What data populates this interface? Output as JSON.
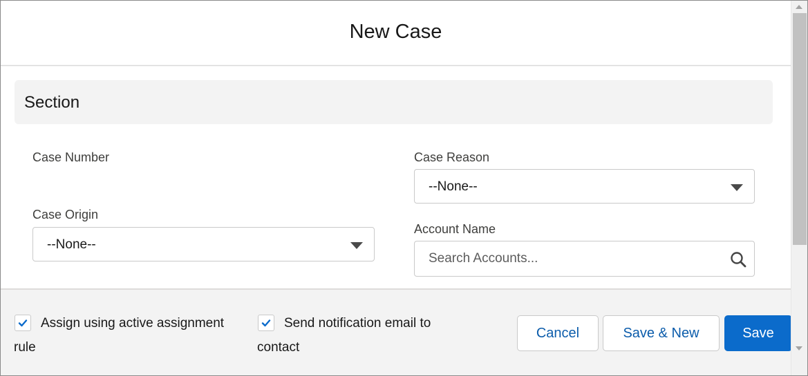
{
  "modal": {
    "title": "New Case"
  },
  "section": {
    "title": "Section"
  },
  "fields": {
    "case_number": {
      "label": "Case Number"
    },
    "case_reason": {
      "label": "Case Reason",
      "value": "--None--"
    },
    "case_origin": {
      "label": "Case Origin",
      "value": "--None--"
    },
    "account_name": {
      "label": "Account Name",
      "placeholder": "Search Accounts..."
    }
  },
  "footer": {
    "assign_rule": {
      "line1": "Assign using active assignment",
      "line2": "rule",
      "checked": true
    },
    "send_email": {
      "line1": "Send notification email to",
      "line2": "contact",
      "checked": true
    },
    "buttons": {
      "cancel": "Cancel",
      "save_new": "Save & New",
      "save": "Save"
    }
  },
  "icons": {
    "search": "search-icon",
    "caret": "chevron-down-icon",
    "check": "check-icon"
  },
  "colors": {
    "brand": "#0b6bcb",
    "link": "#0b5cab",
    "section_bg": "#f3f3f3",
    "footer_bg": "#f3f3f3"
  }
}
